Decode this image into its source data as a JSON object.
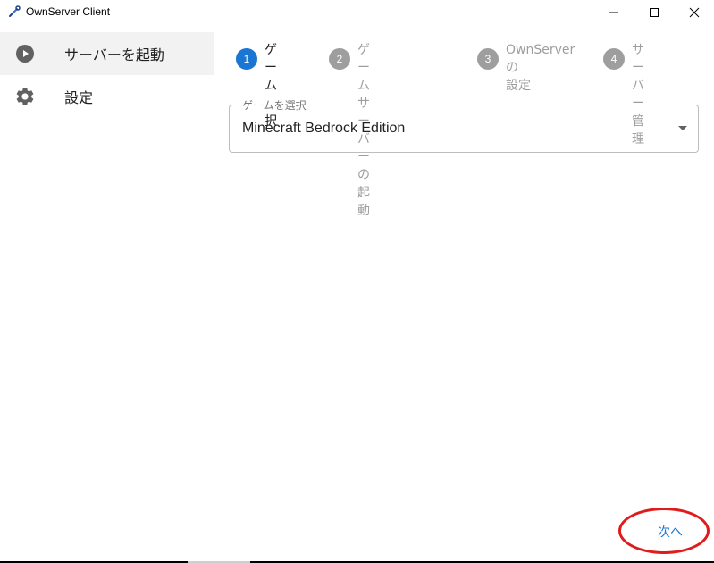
{
  "window": {
    "title": "OwnServer Client",
    "icon": "wrench-plug-icon",
    "controls": [
      "minimize-icon",
      "maximize-icon",
      "close-icon"
    ]
  },
  "sidebar": {
    "items": [
      {
        "label": "サーバーを起動",
        "icon": "play-circle-icon",
        "active": true
      },
      {
        "label": "設定",
        "icon": "gear-icon",
        "active": false
      }
    ]
  },
  "stepper": {
    "steps": [
      {
        "number": "1",
        "label": "ゲーム\n選択",
        "active": true
      },
      {
        "number": "2",
        "label": "ゲームサーバーの\n起動",
        "active": false
      },
      {
        "number": "3",
        "label": "OwnServerの\n設定",
        "active": false
      },
      {
        "number": "4",
        "label": "サーバー\n管理",
        "active": false
      }
    ]
  },
  "game_select": {
    "label": "ゲームを選択",
    "value": "Minecraft Bedrock Edition"
  },
  "actions": {
    "next_label": "次へ"
  },
  "colors": {
    "accent": "#1976d2",
    "inactive_step": "#9e9e9e",
    "annotation": "#e01b1b"
  }
}
